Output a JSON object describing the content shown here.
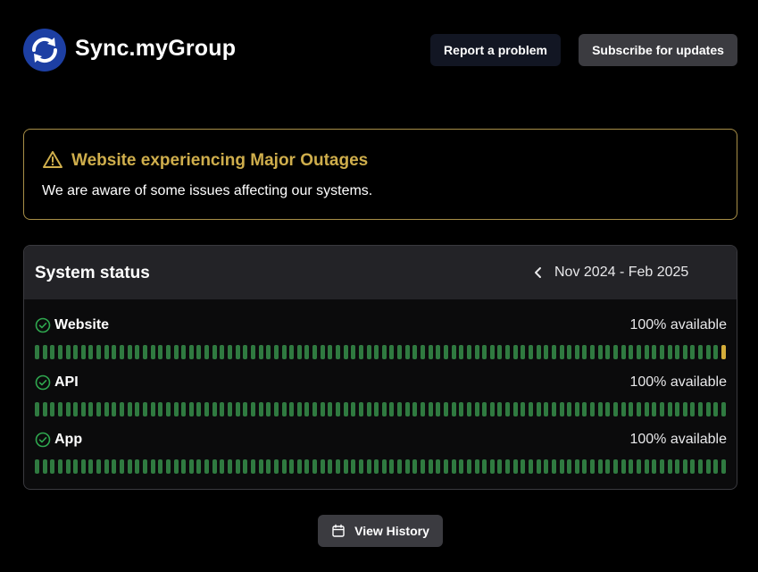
{
  "header": {
    "brand": "Sync.myGroup",
    "report_label": "Report a problem",
    "subscribe_label": "Subscribe for updates",
    "logo_color": "#1d3fa3"
  },
  "alert": {
    "icon": "warning-triangle-icon",
    "title": "Website experiencing Major Outages",
    "message": "We are aware of some issues affecting our systems.",
    "accent": "#cfae4c"
  },
  "status": {
    "title": "System status",
    "range": "Nov 2024 - Feb 2025",
    "services": [
      {
        "name": "Website",
        "availability": "100% available",
        "days": 90,
        "warn_days": [
          90
        ]
      },
      {
        "name": "API",
        "availability": "100% available",
        "days": 90,
        "warn_days": []
      },
      {
        "name": "App",
        "availability": "100% available",
        "days": 90,
        "warn_days": []
      }
    ],
    "ok_color": "#2f7a40",
    "warn_color": "#d4ad3a"
  },
  "footer": {
    "history_label": "View History",
    "history_icon": "calendar-icon"
  }
}
